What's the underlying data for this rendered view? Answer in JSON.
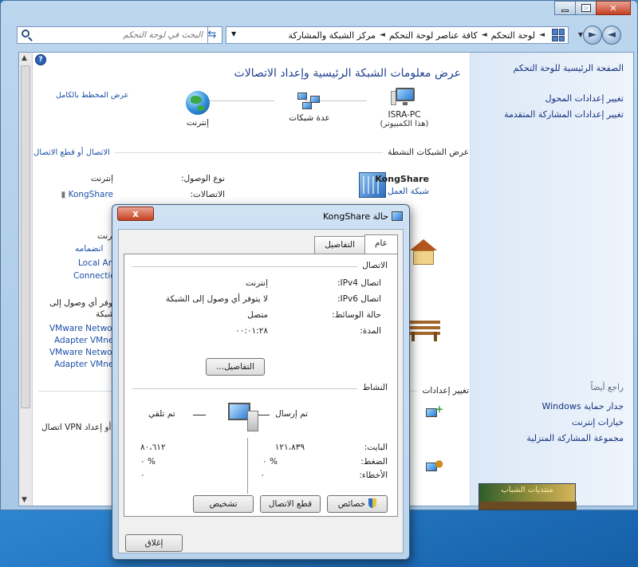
{
  "window": {
    "search_placeholder": "البحث في لوحة التحكم",
    "breadcrumbs": [
      "لوحة التحكم",
      "كافة عناصر لوحة التحكم",
      "مركز الشبكة والمشاركة"
    ]
  },
  "sidebar": {
    "home": "الصفحة الرئيسية للوحة التحكم",
    "links": [
      "تغيير إعدادات المحول",
      "تغيير إعدادات المشاركة المتقدمة"
    ],
    "see_also_title": "راجع أيضاً",
    "see_also": [
      "جدار حماية Windows",
      "خيارات إنترنت",
      "مجموعة المشاركة المنزلية"
    ]
  },
  "main": {
    "title": "عرض معلومات الشبكة الرئيسية وإعداد الاتصالات",
    "full_map": "عرض المخطط بالكامل",
    "pc_name": "ISRA-PC",
    "pc_sub": "(هذا الكمبيوتر)",
    "multi_networks": "عدة شبكات",
    "internet": "إنترنت",
    "active_networks": "عرض الشبكات النشطة",
    "connect_disconnect": "الاتصال أو قطع الاتصال",
    "network_name": "KongShare",
    "network_type": "شبكة العمل",
    "access_type_label": "نوع الوصول:",
    "access_type_value": "إنترنت",
    "connections_label": "الاتصالات:",
    "connections_value": "KongShare",
    "change_settings": "تغيير إعدادات",
    "left_fragments": {
      "f_internet": "إنترنت",
      "f_join": "انضمامه",
      "f_local": "Local Are",
      "f_connection": "Connectio",
      "f_noaccess1": "لا يتوفر أي وصول إلى",
      "f_noaccess2": "الشبكة",
      "f_vm1": "VMware Netwo",
      "f_vm2": "Adapter VMne",
      "f_vm3": "VMware Netwo",
      "f_vm4": "Adapter VMne",
      "f_vpn": "اتصال VPN أو إعداد"
    }
  },
  "dialog": {
    "title": "حالة KongShare",
    "close_label": "x",
    "tabs": [
      "عام",
      "التفاصيل"
    ],
    "connection_group": "الاتصال",
    "rows": [
      {
        "k": "اتصال IPv4:",
        "v": "إنترنت"
      },
      {
        "k": "اتصال IPv6:",
        "v": "لا يتوفر أي وصول إلى الشبكة"
      },
      {
        "k": "حالة الوسائط:",
        "v": "متصل"
      },
      {
        "k": "المدة:",
        "v": "٠٠:٠١:٢٨"
      }
    ],
    "details_button": "التفاصيل...",
    "activity_group": "النشاط",
    "sent_label": "تم إرسال",
    "received_label": "تم تلقي",
    "bytes_label": "البايت:",
    "compression_label": "الضغط:",
    "errors_label": "الأخطاء:",
    "sent_bytes": "١٢١،٨٣٩",
    "received_bytes": "٨٠،٦١٢",
    "sent_compression": "% ٠",
    "received_compression": "% ٠",
    "sent_errors": "٠",
    "received_errors": "٠",
    "properties_button": "خصائص",
    "disconnect_button": "قطع الاتصال",
    "diagnose_button": "تشخيص",
    "close_button": "إغلاق"
  },
  "watermark": {
    "text": "منتديات الشباب"
  }
}
